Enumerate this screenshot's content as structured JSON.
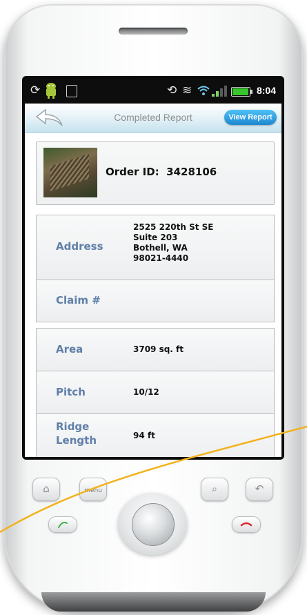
{
  "statusbar": {
    "time": "8:04"
  },
  "titlebar": {
    "title": "Completed Report",
    "view_report": "View Report"
  },
  "order": {
    "label": "Order ID:",
    "id": "3428106"
  },
  "address": {
    "label": "Address",
    "lines": [
      "2525 220th St SE",
      "Suite 203",
      "Bothell, WA",
      "98021-4440"
    ]
  },
  "claim": {
    "label": "Claim #"
  },
  "area": {
    "label": "Area",
    "value": "3709 sq. ft"
  },
  "pitch": {
    "label": "Pitch",
    "value": "10/12"
  },
  "ridge": {
    "label_1": "Ridge",
    "label_2": "Length",
    "value": "94 ft"
  },
  "hardware": {
    "menu_label": "menu"
  },
  "icons": [
    "back-arrow-icon",
    "home-icon",
    "menu-icon",
    "search-icon",
    "back-icon",
    "call-icon",
    "end-call-icon",
    "trackball-icon",
    "sync-icon",
    "android-icon",
    "usb-icon",
    "vibrate-icon",
    "wifi-icon",
    "signal-icon",
    "battery-icon"
  ],
  "colors": {
    "label_blue": "#5f7fa8",
    "view_report_blue": "#1e86d1",
    "call_green": "#3fb14a",
    "end_red": "#d9262c",
    "annotation_line": "#f2b21c"
  }
}
